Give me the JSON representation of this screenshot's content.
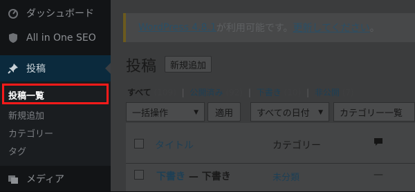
{
  "sidebar": {
    "items": [
      {
        "label": "ダッシュボード",
        "icon": "dashboard-icon"
      },
      {
        "label": "All in One SEO",
        "icon": "shield-icon"
      },
      {
        "label": "投稿",
        "icon": "pin-icon"
      },
      {
        "label": "メディア",
        "icon": "media-icon"
      }
    ],
    "submenu": [
      "投稿一覧",
      "新規追加",
      "カテゴリー",
      "タグ"
    ]
  },
  "notice": {
    "link1": "WordPress 4.8.1",
    "text": " が利用可能です。",
    "link2": "更新してください",
    "end": "。"
  },
  "header": {
    "title": "投稿",
    "add_new": "新規追加"
  },
  "filters": {
    "all": "すべて",
    "all_count": "(109)",
    "published": "公開済み",
    "published_count": "(92)",
    "draft": "下書き",
    "draft_count": "(10)",
    "private": "非公開",
    "private_count": "(7)"
  },
  "bulk": {
    "action": "一括操作",
    "apply": "適用",
    "dates": "すべての日付",
    "category": "カテゴリー一覧"
  },
  "table": {
    "columns": {
      "title": "タイトル",
      "category": "カテゴリー"
    },
    "rows": [
      {
        "title": "下書き",
        "suffix": " — 下書き",
        "category": "未分類",
        "comments": "—"
      }
    ]
  },
  "colors": {
    "highlight": "#ff1a1a",
    "sidebar_active": "#0b2a3d"
  }
}
